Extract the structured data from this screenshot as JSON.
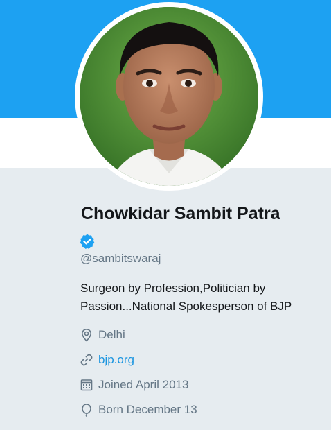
{
  "profile": {
    "display_name": "Chowkidar Sambit Patra",
    "verified": true,
    "handle": "@sambitswaraj",
    "bio": "Surgeon by Profession,Politician by Passion...National Spokesperson of BJP",
    "location": "Delhi",
    "website": "bjp.org",
    "joined": "Joined April 2013",
    "born": "Born December 13"
  },
  "icons": {
    "verified": "verified-badge-icon",
    "location": "location-pin-icon",
    "website": "link-icon",
    "joined": "calendar-icon",
    "born": "balloon-icon"
  },
  "colors": {
    "banner": "#1da1f2",
    "panel": "#e6ecf0",
    "link": "#1b95e0",
    "secondary_text": "#657786",
    "primary_text": "#14171a"
  }
}
